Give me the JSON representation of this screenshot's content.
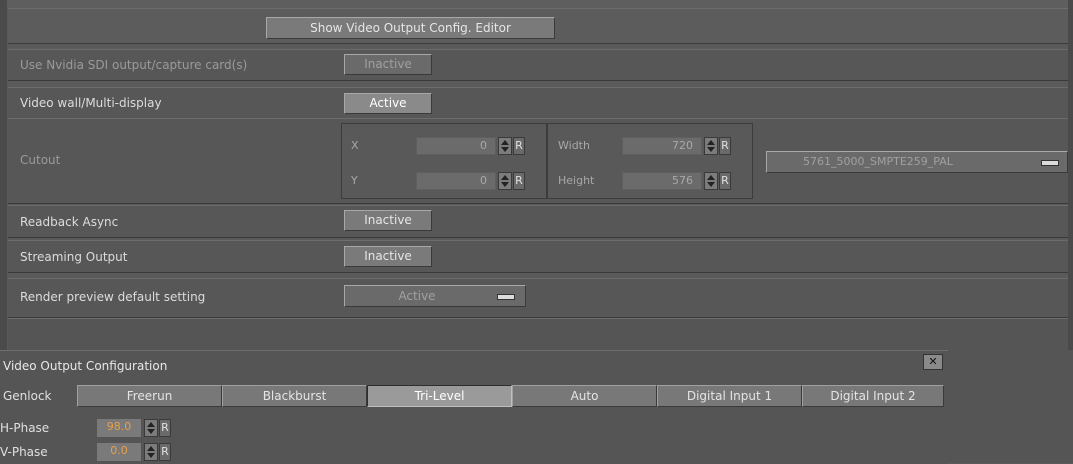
{
  "header": {
    "show_editor_label": "Show Video Output Config. Editor"
  },
  "rows": {
    "nvidia": {
      "label": "Use Nvidia SDI output/capture card(s)",
      "value": "Inactive"
    },
    "videowall": {
      "label": "Video wall/Multi-display",
      "value": "Active"
    },
    "cutout": {
      "label": "Cutout",
      "x_label": "X",
      "x_value": "0",
      "y_label": "Y",
      "y_value": "0",
      "width_label": "Width",
      "width_value": "720",
      "height_label": "Height",
      "height_value": "576",
      "reset": "R",
      "format": "5761_5000_SMPTE259_PAL"
    },
    "readback": {
      "label": "Readback Async",
      "value": "Inactive"
    },
    "streaming": {
      "label": "Streaming Output",
      "value": "Inactive"
    },
    "preview": {
      "label": "Render preview default setting",
      "value": "Active"
    }
  },
  "video_output": {
    "title": "Video Output Configuration",
    "close": "✕",
    "genlock_label": "Genlock",
    "tabs": [
      "Freerun",
      "Blackburst",
      "Tri-Level",
      "Auto",
      "Digital Input 1",
      "Digital Input 2"
    ],
    "selected_tab": "Tri-Level",
    "h_phase_label": "H-Phase",
    "h_phase_value": "98.0",
    "v_phase_label": "V-Phase",
    "v_phase_value": "0.0",
    "reset": "R"
  },
  "colors": {
    "panel": "#575757",
    "accent_value": "#e8a04a"
  }
}
